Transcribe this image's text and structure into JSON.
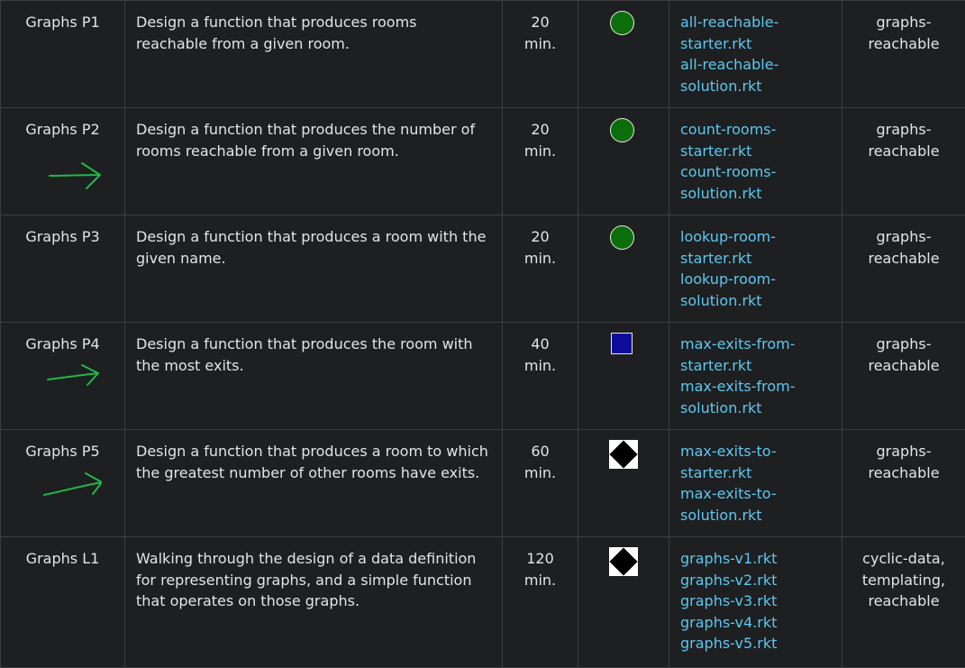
{
  "rows": [
    {
      "name": "Graphs P1",
      "description": "Design a function that produces rooms reachable from a given room.",
      "time": "20 min.",
      "difficulty_icon": "green-circle-icon",
      "files": [
        "all-reachable-starter.rkt",
        "all-reachable-solution.rkt"
      ],
      "tags": "graphs-reachable",
      "arrow": false
    },
    {
      "name": "Graphs P2",
      "description": "Design a function that produces the number of rooms reachable from a given room.",
      "time": "20 min.",
      "difficulty_icon": "green-circle-icon",
      "files": [
        "count-rooms-starter.rkt",
        "count-rooms-solution.rkt"
      ],
      "tags": "graphs-reachable",
      "arrow": true
    },
    {
      "name": "Graphs P3",
      "description": "Design a function that produces a room with the given name.",
      "time": "20 min.",
      "difficulty_icon": "green-circle-icon",
      "files": [
        "lookup-room-starter.rkt",
        "lookup-room-solution.rkt"
      ],
      "tags": "graphs-reachable",
      "arrow": false
    },
    {
      "name": "Graphs P4",
      "description": "Design a function that produces the room with the most exits.",
      "time": "40 min.",
      "difficulty_icon": "blue-square-icon",
      "files": [
        "max-exits-from-starter.rkt",
        "max-exits-from-solution.rkt"
      ],
      "tags": "graphs-reachable",
      "arrow": true
    },
    {
      "name": "Graphs P5",
      "description": "Design a function that produces a room to which the greatest number of other rooms have exits.",
      "time": "60 min.",
      "difficulty_icon": "black-diamond-icon",
      "files": [
        "max-exits-to-starter.rkt",
        "max-exits-to-solution.rkt"
      ],
      "tags": "graphs-reachable",
      "arrow": true
    },
    {
      "name": "Graphs L1",
      "description": "Walking through the design of a data definition for representing graphs, and a simple function that operates on those graphs.",
      "time": "120 min.",
      "difficulty_icon": "black-diamond-icon",
      "files": [
        "graphs-v1.rkt",
        "graphs-v2.rkt",
        "graphs-v3.rkt",
        "graphs-v4.rkt",
        "graphs-v5.rkt"
      ],
      "tags": "cyclic-data, templating, reachable",
      "arrow": false
    }
  ],
  "colors": {
    "background": "#1e1f21",
    "text": "#e4e4e6",
    "link": "#5cc8ef",
    "border": "#3c3d40",
    "green_circle": "#0b6e0b",
    "blue_square": "#0d0d9a",
    "annotation_arrow": "#1fb84a"
  }
}
